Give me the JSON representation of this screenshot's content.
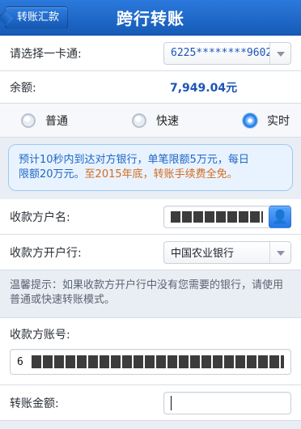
{
  "header": {
    "back_label": "转账汇款",
    "title": "跨行转账"
  },
  "form": {
    "select_card": {
      "label": "请选择一卡通:",
      "value": "6225********9602"
    },
    "balance": {
      "label": "余额:",
      "value": "7,949.04元"
    },
    "transfer_mode": {
      "options": [
        {
          "label": "普通",
          "selected": false
        },
        {
          "label": "快速",
          "selected": false
        },
        {
          "label": "实时",
          "selected": true
        }
      ]
    },
    "notice": {
      "line1": "预计10秒内到达对方银行，单笔限额5万元，每日",
      "line2": "限额20万元。",
      "line3": "至2015年底，转账手续费全免。"
    },
    "payee_name": {
      "label": "收款方户名:"
    },
    "payee_bank": {
      "label": "收款方开户行:",
      "value": "中国农业银行"
    },
    "tip": {
      "text": "温馨提示：如果收款方开户行中没有您需要的银行，请使用普通或快速转账模式。"
    },
    "payee_account": {
      "label": "收款方账号:",
      "prefix": "6"
    },
    "amount": {
      "label": "转账金额:"
    }
  },
  "colors": {
    "accent_blue": "#1e67c9",
    "notice_blue": "#1f66c5",
    "notice_orange": "#d46a1d"
  },
  "icons": {
    "back": "chevron-left-icon",
    "dropdown": "dropdown-triangle-icon",
    "contacts": "contacts-icon"
  }
}
